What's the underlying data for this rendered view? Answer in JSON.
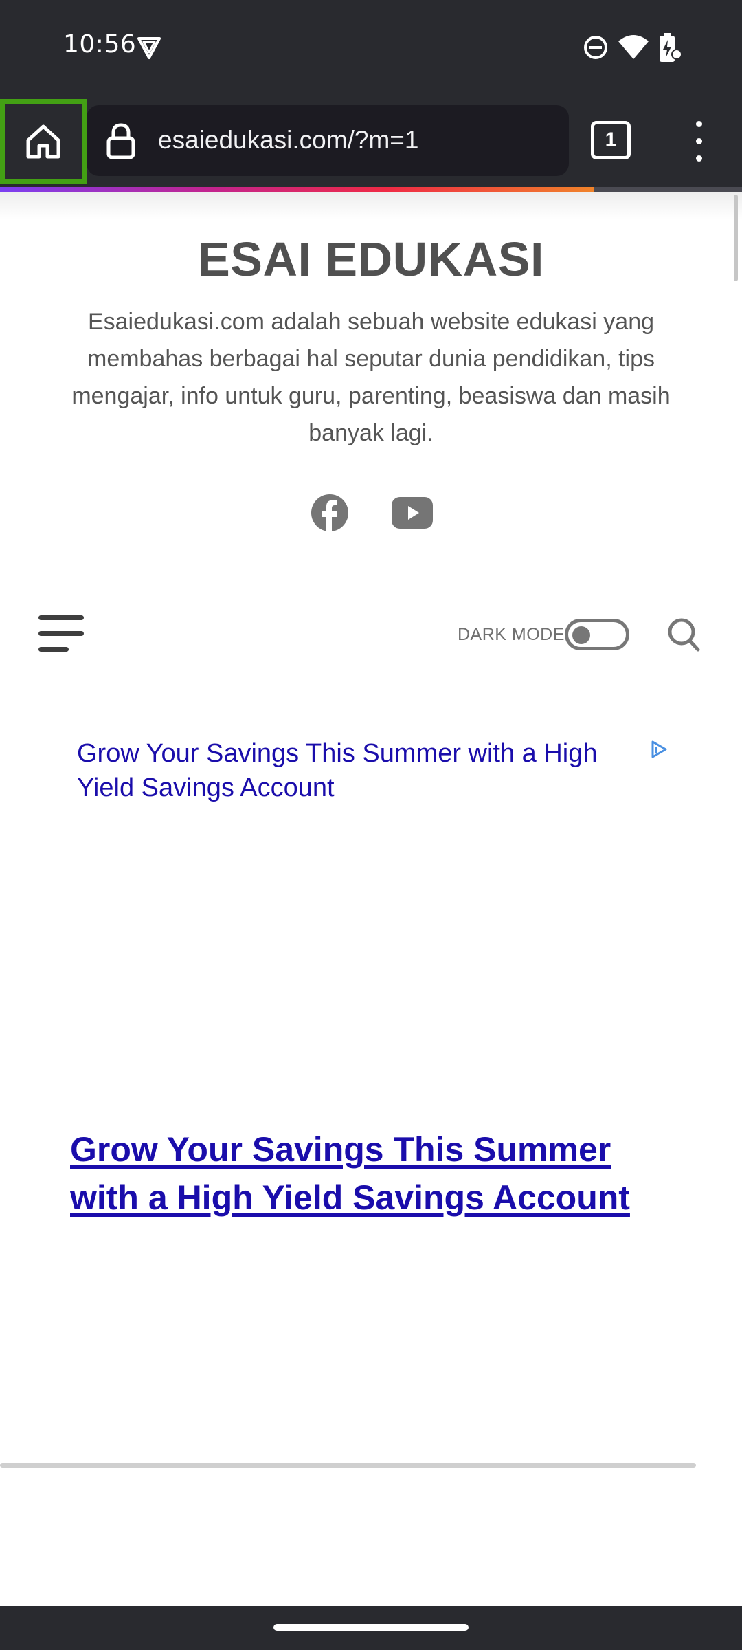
{
  "status_bar": {
    "time": "10:56",
    "icons": [
      "vpn-shield-icon",
      "do-not-disturb-icon",
      "wifi-icon",
      "battery-charging-icon"
    ]
  },
  "browser": {
    "url": "esaiedukasi.com/?m=1",
    "tab_count": "1",
    "load_progress": 0.8,
    "icons": [
      "home-icon",
      "lock-icon",
      "tabs-icon",
      "overflow-menu-icon"
    ]
  },
  "site": {
    "title": "ESAI EDUKASI",
    "description": "Esaiedukasi.com adalah sebuah website edukasi yang membahas berbagai hal seputar dunia pendidikan, tips mengajar, info untuk guru, parenting, beasiswa dan masih banyak lagi.",
    "social_icons": [
      "facebook-icon",
      "youtube-icon"
    ]
  },
  "nav": {
    "dark_mode_label": "DARK MODE",
    "dark_mode_on": false
  },
  "ad": {
    "link_text": "Grow Your Savings This Summer with a High Yield Savings Account",
    "headline": "Grow Your Savings This Summer with a High Yield Savings Account"
  },
  "colors": {
    "chrome": "#292a2f",
    "url_bar": "#1c1b22",
    "highlight": "#43a014",
    "link": "#1a0dab",
    "title": "#505050"
  }
}
